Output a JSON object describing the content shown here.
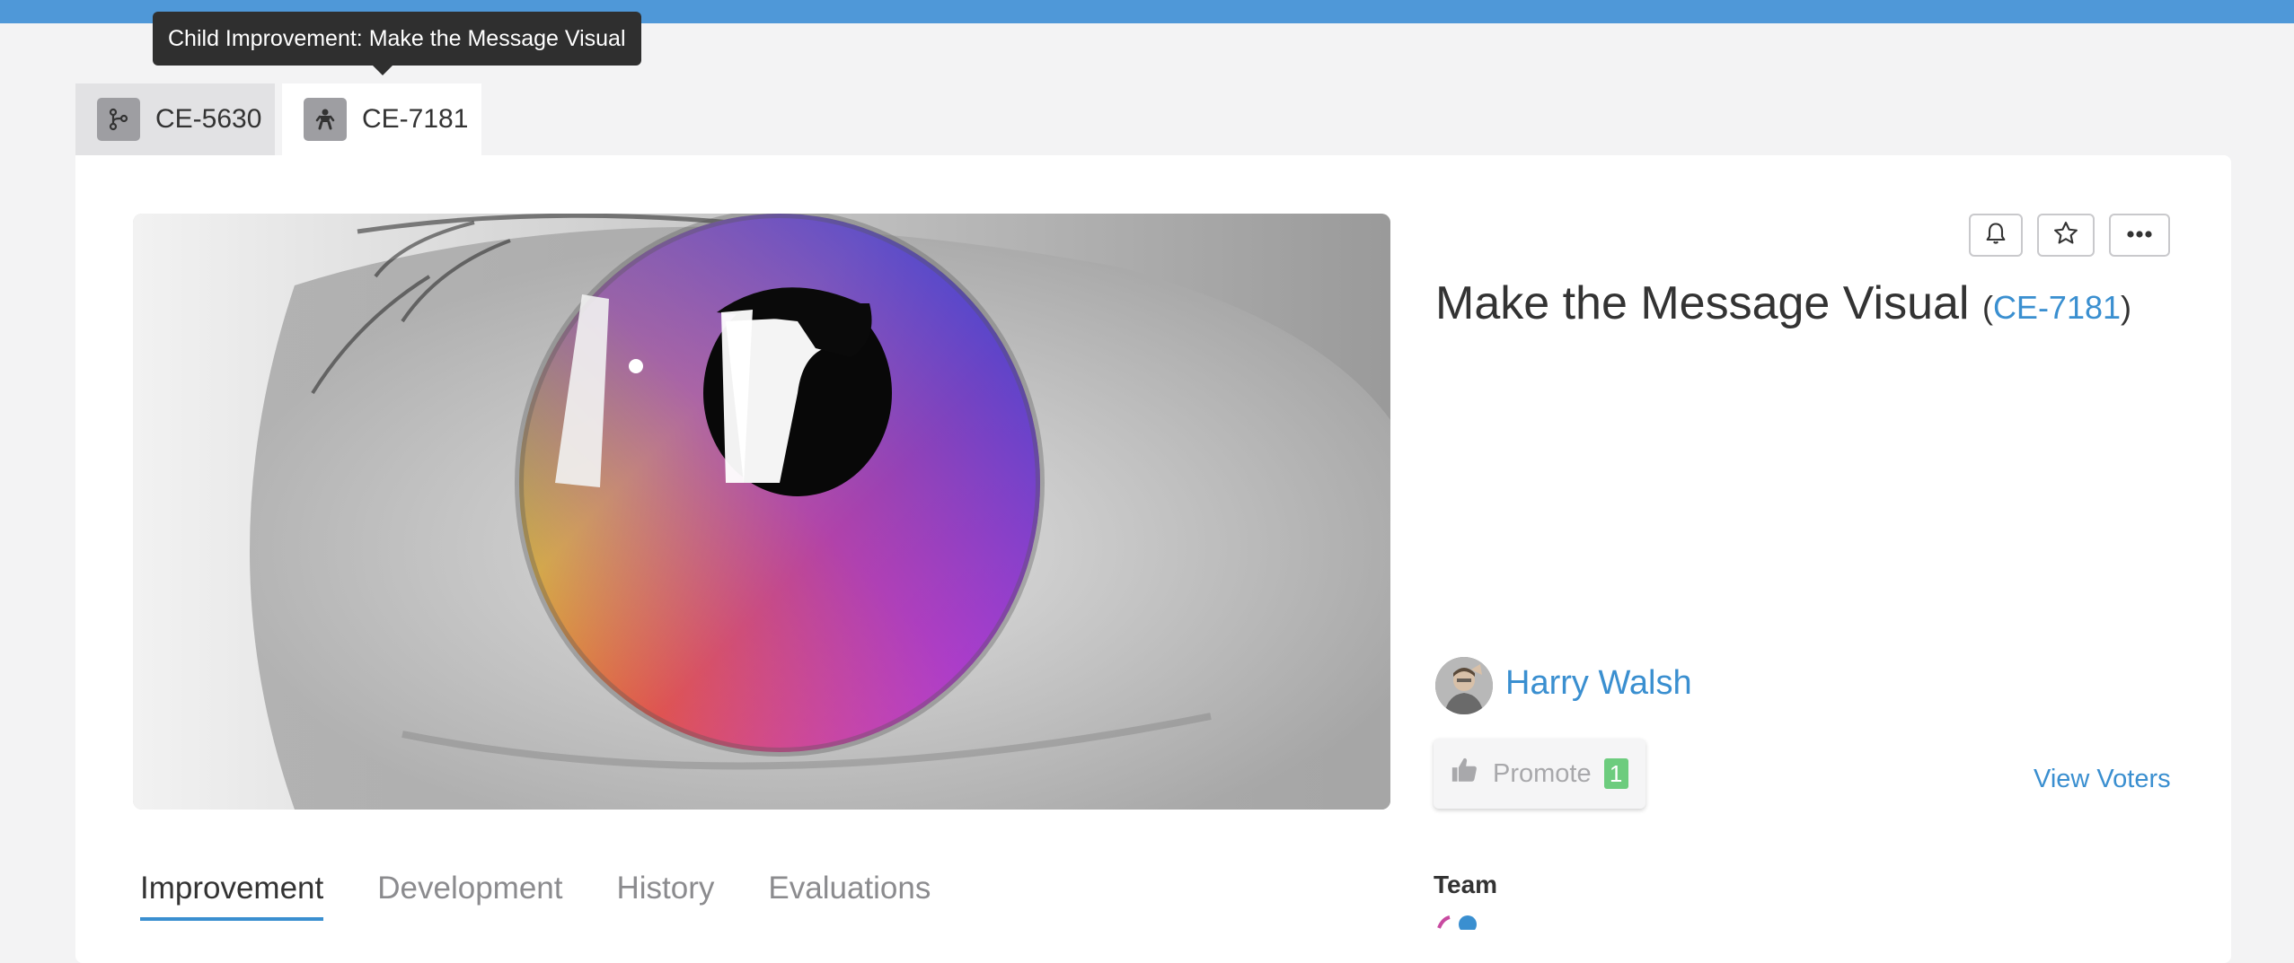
{
  "tooltip": {
    "text": "Child Improvement: Make the Message Visual"
  },
  "tabs": [
    {
      "label": "CE-5630",
      "icon": "branch-icon"
    },
    {
      "label": "CE-7181",
      "icon": "child-icon"
    }
  ],
  "idea": {
    "title": "Make the Message Visual",
    "code": "CE-7181",
    "author": "Harry Walsh"
  },
  "actions": {
    "notify_icon": "bell-icon",
    "favorite_icon": "star-icon",
    "more_icon": "ellipsis-icon"
  },
  "promote": {
    "label": "Promote",
    "count": "1",
    "view_voters": "View Voters"
  },
  "subtabs": [
    "Improvement",
    "Development",
    "History",
    "Evaluations"
  ],
  "team": {
    "label": "Team"
  },
  "colors": {
    "accent": "#3a8fd0",
    "topbar": "#4f98d8",
    "promote_count": "#6dcc7e",
    "tooltip_bg": "#2f2f2f"
  }
}
